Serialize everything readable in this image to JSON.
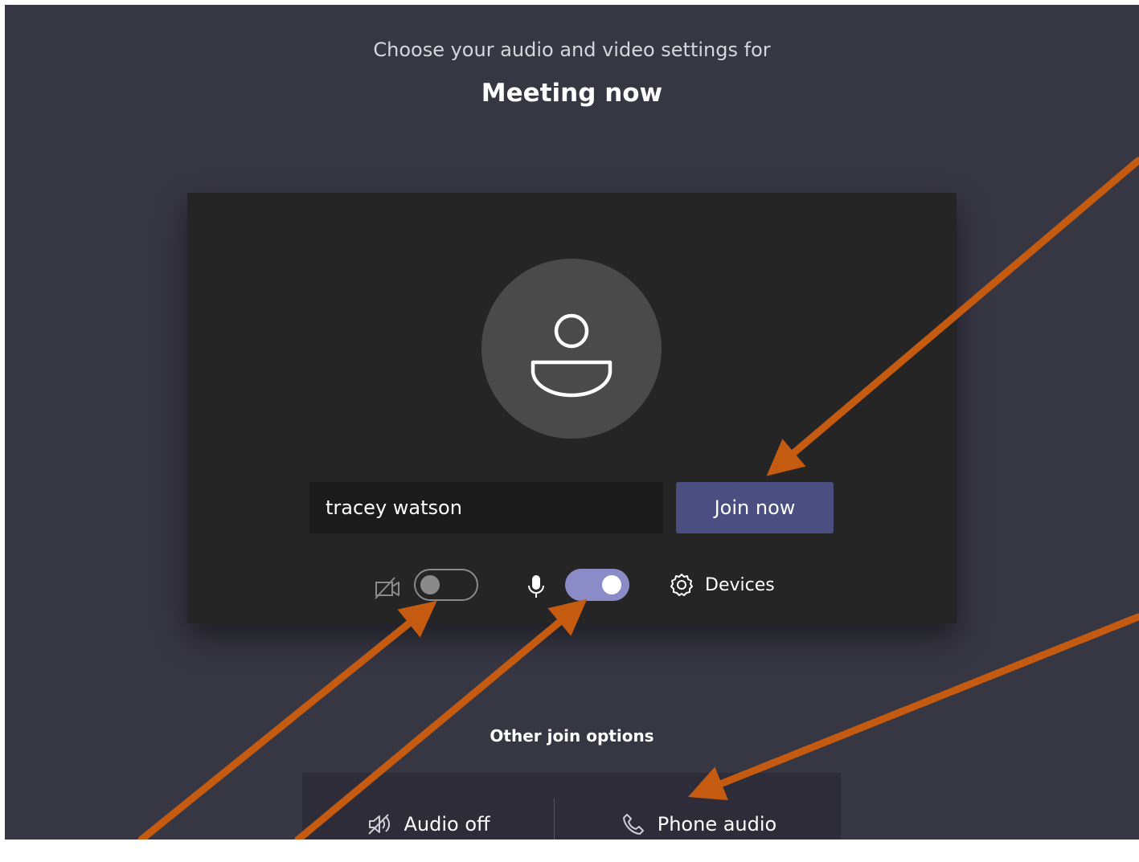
{
  "header": {
    "subtitle": "Choose your audio and video settings for",
    "meeting_title": "Meeting now"
  },
  "preview": {
    "avatar_icon": "person-icon",
    "name_input_value": "tracey watson",
    "join_button_label": "Join now"
  },
  "controls": {
    "camera": {
      "icon": "camera-off-icon",
      "enabled": false
    },
    "microphone": {
      "icon": "microphone-icon",
      "enabled": true
    },
    "devices": {
      "icon": "gear-icon",
      "label": "Devices"
    }
  },
  "other_options": {
    "heading": "Other join options",
    "items": [
      {
        "icon": "speaker-off-icon",
        "label": "Audio off"
      },
      {
        "icon": "phone-icon",
        "label": "Phone audio"
      }
    ]
  },
  "colors": {
    "background": "#373643",
    "panel": "#252526",
    "join_button": "#4b4e81",
    "toggle_on": "#8b8cc7",
    "annotation_arrow": "#c55a11"
  }
}
